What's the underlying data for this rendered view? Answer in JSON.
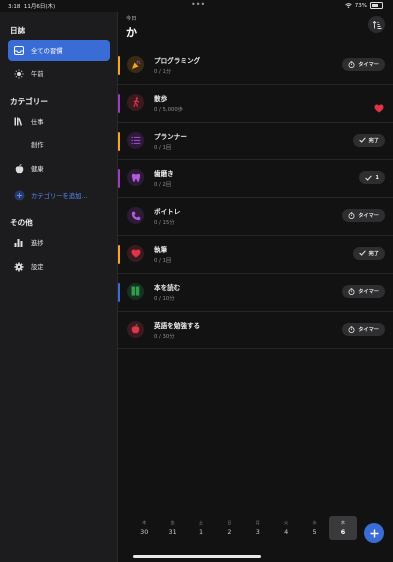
{
  "status": {
    "time": "3:18",
    "date": "11月6日(木)",
    "dots": "•••",
    "battery": "73%"
  },
  "sidebar": {
    "sections": [
      {
        "title": "日誌",
        "items": [
          {
            "label": "全ての習慣",
            "icon": "tray-icon",
            "active": true
          },
          {
            "label": "午前",
            "icon": "sun-icon"
          }
        ]
      },
      {
        "title": "カテゴリー",
        "items": [
          {
            "label": "仕事",
            "icon": "books-icon"
          },
          {
            "label": "創作",
            "icon": ""
          },
          {
            "label": "健康",
            "icon": "apple-icon"
          },
          {
            "label": "カテゴリーを追加…",
            "icon": "plus-circle-icon"
          }
        ]
      },
      {
        "title": "その他",
        "items": [
          {
            "label": "進捗",
            "icon": "chart-icon"
          },
          {
            "label": "設定",
            "icon": "gear-icon"
          }
        ]
      }
    ]
  },
  "header": {
    "label": "今日",
    "title": "か"
  },
  "habits": [
    {
      "name": "プログラミング",
      "progress": "0 / 1分",
      "color": "#f5a623",
      "iconColor": "#f5a623",
      "iconBg": "#3a2c14",
      "action": "タイマー",
      "actionType": "timer"
    },
    {
      "name": "散歩",
      "progress": "0 / 5,000歩",
      "color": "#9b3cc2",
      "iconColor": "#e0344a",
      "iconBg": "#3a1a1f",
      "action": "",
      "actionType": "heart"
    },
    {
      "name": "プランナー",
      "progress": "0 / 1回",
      "color": "#f5a623",
      "iconColor": "#a44ad8",
      "iconBg": "#2c1a38",
      "action": "完了",
      "actionType": "done"
    },
    {
      "name": "歯磨き",
      "progress": "0 / 2回",
      "color": "#9b3cc2",
      "iconColor": "#b25bdc",
      "iconBg": "#2d1a37",
      "action": "1",
      "actionType": "count"
    },
    {
      "name": "ボイトレ",
      "progress": "0 / 15分",
      "color": "",
      "iconColor": "#b25bdc",
      "iconBg": "#2d1a37",
      "action": "タイマー",
      "actionType": "timer"
    },
    {
      "name": "執筆",
      "progress": "0 / 1回",
      "color": "#f5a623",
      "iconColor": "#e0344a",
      "iconBg": "#3a1a1f",
      "action": "完了",
      "actionType": "done"
    },
    {
      "name": "本を読む",
      "progress": "0 / 10分",
      "color": "#3a6cd6",
      "iconColor": "#2e9e4a",
      "iconBg": "#173020",
      "action": "タイマー",
      "actionType": "timer"
    },
    {
      "name": "英語を勉強する",
      "progress": "0 / 30分",
      "color": "",
      "iconColor": "#e0344a",
      "iconBg": "#3a1a1f",
      "action": "タイマー",
      "actionType": "timer"
    }
  ],
  "week": [
    {
      "w": "木",
      "d": "30"
    },
    {
      "w": "金",
      "d": "31"
    },
    {
      "w": "土",
      "d": "1"
    },
    {
      "w": "日",
      "d": "2"
    },
    {
      "w": "月",
      "d": "3"
    },
    {
      "w": "火",
      "d": "4"
    },
    {
      "w": "水",
      "d": "5"
    },
    {
      "w": "木",
      "d": "6",
      "selected": true
    }
  ]
}
